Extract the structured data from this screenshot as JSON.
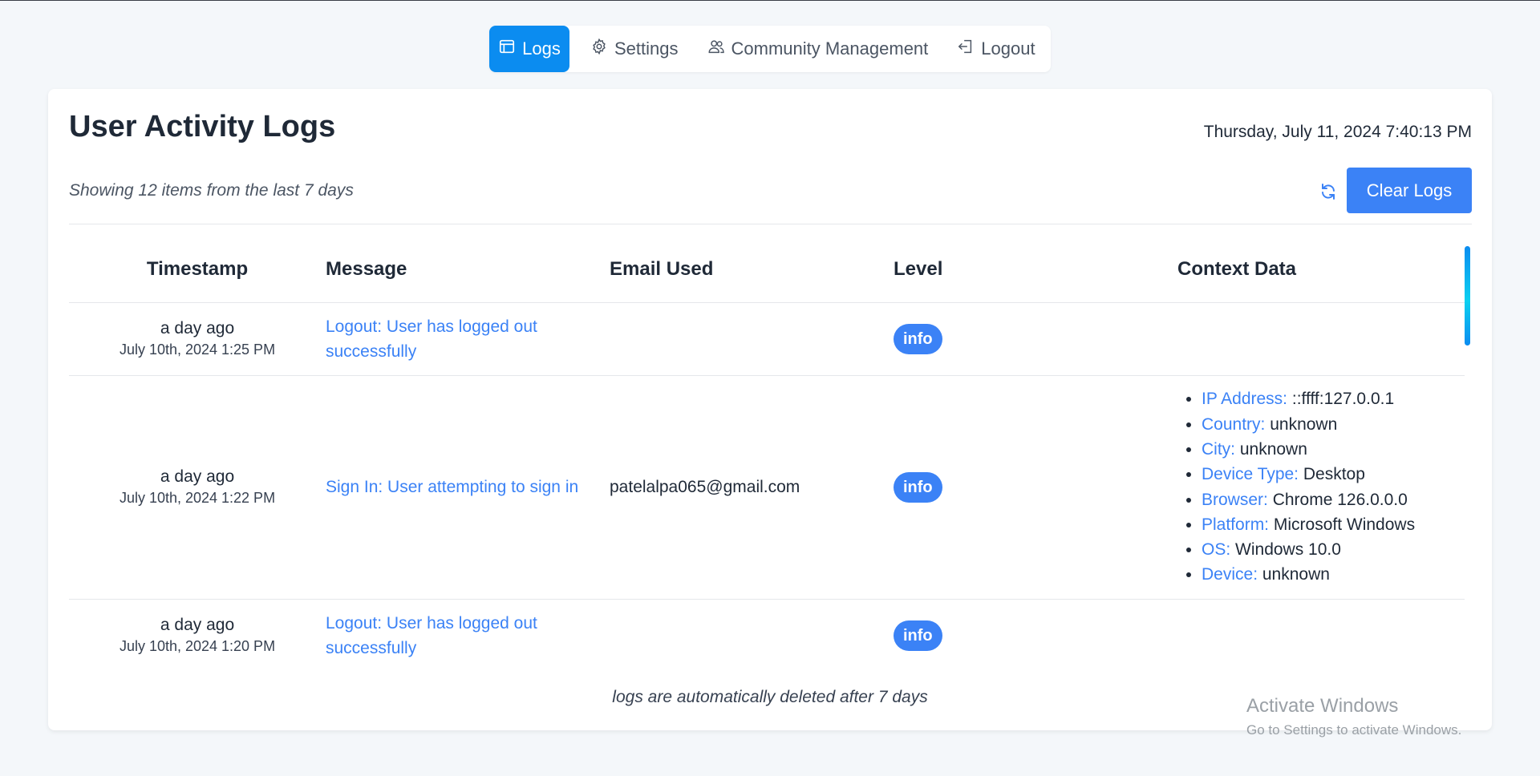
{
  "nav": {
    "logs": "Logs",
    "settings": "Settings",
    "community": "Community Management",
    "logout": "Logout"
  },
  "page": {
    "title": "User Activity Logs",
    "datetime": "Thursday, July 11, 2024 7:40:13 PM",
    "showing": "Showing 12 items from the last 7 days",
    "clear_label": "Clear Logs",
    "footer_note": "logs are automatically deleted after 7 days"
  },
  "table": {
    "headers": [
      "Timestamp",
      "Message",
      "Email Used",
      "Level",
      "Context Data"
    ],
    "rows": [
      {
        "relative": "a day ago",
        "absolute": "July 10th, 2024 1:25 PM",
        "message": "Logout: User has logged out successfully",
        "email": "",
        "level": "info",
        "context": []
      },
      {
        "relative": "a day ago",
        "absolute": "July 10th, 2024 1:22 PM",
        "message": "Sign In: User attempting to sign in",
        "email": "patelalpa065@gmail.com",
        "level": "info",
        "context": [
          {
            "key": "IP Address:",
            "value": "::ffff:127.0.0.1"
          },
          {
            "key": "Country:",
            "value": "unknown"
          },
          {
            "key": "City:",
            "value": "unknown"
          },
          {
            "key": "Device Type:",
            "value": "Desktop"
          },
          {
            "key": "Browser:",
            "value": "Chrome 126.0.0.0"
          },
          {
            "key": "Platform:",
            "value": "Microsoft Windows"
          },
          {
            "key": "OS:",
            "value": "Windows 10.0"
          },
          {
            "key": "Device:",
            "value": "unknown"
          }
        ]
      },
      {
        "relative": "a day ago",
        "absolute": "July 10th, 2024 1:20 PM",
        "message": "Logout: User has logged out successfully",
        "email": "",
        "level": "info",
        "context": []
      }
    ]
  },
  "watermark": {
    "line1": "Activate Windows",
    "line2": "Go to Settings to activate Windows."
  },
  "colors": {
    "accent": "#3b82f6",
    "nav_active": "#0b8cf0",
    "background": "#f4f7fa"
  },
  "icons": {
    "logs": "browser-window-icon",
    "settings": "gear-icon",
    "community": "users-icon",
    "logout": "logout-icon",
    "refresh": "refresh-icon"
  }
}
